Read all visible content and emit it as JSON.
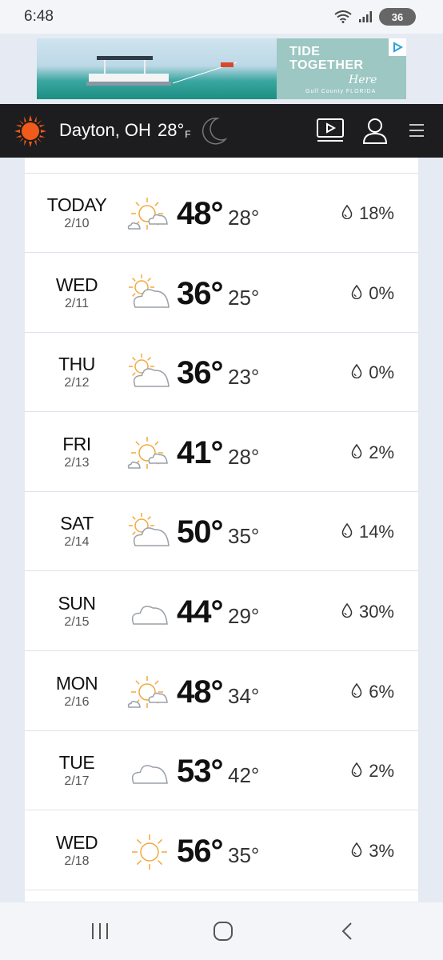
{
  "status_bar": {
    "time": "6:48",
    "battery": "36"
  },
  "ad": {
    "headline_line1": "TIDE",
    "headline_line2": "TOGETHER",
    "script_text": "Here",
    "sub_text": "Gulf County FLORIDA"
  },
  "header": {
    "location": "Dayton, OH",
    "current_temp": "28°",
    "unit": "F"
  },
  "forecast": [
    {
      "day": "TODAY",
      "date": "2/10",
      "high": "48°",
      "low": "28°",
      "precip": "18%",
      "icon": "partly-sunny-icon"
    },
    {
      "day": "WED",
      "date": "2/11",
      "high": "36°",
      "low": "25°",
      "precip": "0%",
      "icon": "mostly-cloudy-icon"
    },
    {
      "day": "THU",
      "date": "2/12",
      "high": "36°",
      "low": "23°",
      "precip": "0%",
      "icon": "mostly-cloudy-icon"
    },
    {
      "day": "FRI",
      "date": "2/13",
      "high": "41°",
      "low": "28°",
      "precip": "2%",
      "icon": "partly-sunny-icon"
    },
    {
      "day": "SAT",
      "date": "2/14",
      "high": "50°",
      "low": "35°",
      "precip": "14%",
      "icon": "mostly-cloudy-icon"
    },
    {
      "day": "SUN",
      "date": "2/15",
      "high": "44°",
      "low": "29°",
      "precip": "30%",
      "icon": "cloudy-icon"
    },
    {
      "day": "MON",
      "date": "2/16",
      "high": "48°",
      "low": "34°",
      "precip": "6%",
      "icon": "partly-sunny-icon"
    },
    {
      "day": "TUE",
      "date": "2/17",
      "high": "53°",
      "low": "42°",
      "precip": "2%",
      "icon": "cloudy-icon"
    },
    {
      "day": "WED",
      "date": "2/18",
      "high": "56°",
      "low": "35°",
      "precip": "3%",
      "icon": "sunny-icon"
    }
  ],
  "colors": {
    "header_bg": "#1d1d1f",
    "logo_orange": "#f05a1a",
    "sun_yellow": "#f2a93b",
    "cloud_gray": "#9aa0a8",
    "page_bg": "#e6ebf3"
  }
}
